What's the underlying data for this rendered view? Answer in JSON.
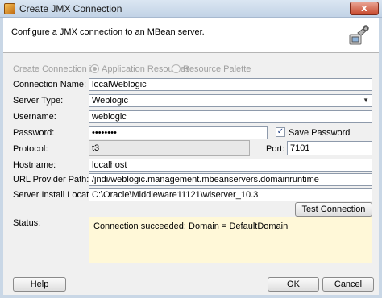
{
  "window": {
    "title": "Create JMX Connection",
    "close_label": "x"
  },
  "header": {
    "description": "Configure a JMX connection to an MBean server.",
    "icon": "connection-wizard-icon"
  },
  "create_in": {
    "label": "Create Connection in:",
    "options": [
      "Application Resources",
      "Resource Palette"
    ],
    "selected": "Application Resources"
  },
  "form": {
    "connection_name": {
      "label": "Connection Name:",
      "value": "localWeblogic"
    },
    "server_type": {
      "label": "Server Type:",
      "value": "Weblogic"
    },
    "username": {
      "label": "Username:",
      "value": "weblogic"
    },
    "password": {
      "label": "Password:",
      "value": "••••••••"
    },
    "save_password": {
      "label": "Save Password",
      "checked": true
    },
    "protocol": {
      "label": "Protocol:",
      "value": "t3"
    },
    "port": {
      "label": "Port:",
      "value": "7101"
    },
    "hostname": {
      "label": "Hostname:",
      "value": "localhost"
    },
    "url_provider_path": {
      "label": "URL Provider Path:",
      "value": "/jndi/weblogic.management.mbeanservers.domainruntime"
    },
    "server_install_location": {
      "label": "Server Install Location:",
      "value": "C:\\Oracle\\Middleware11121\\wlserver_10.3"
    }
  },
  "test_button": "Test Connection",
  "status": {
    "label": "Status:",
    "text": "Connection succeeded: Domain = DefaultDomain"
  },
  "footer": {
    "help": "Help",
    "ok": "OK",
    "cancel": "Cancel"
  }
}
